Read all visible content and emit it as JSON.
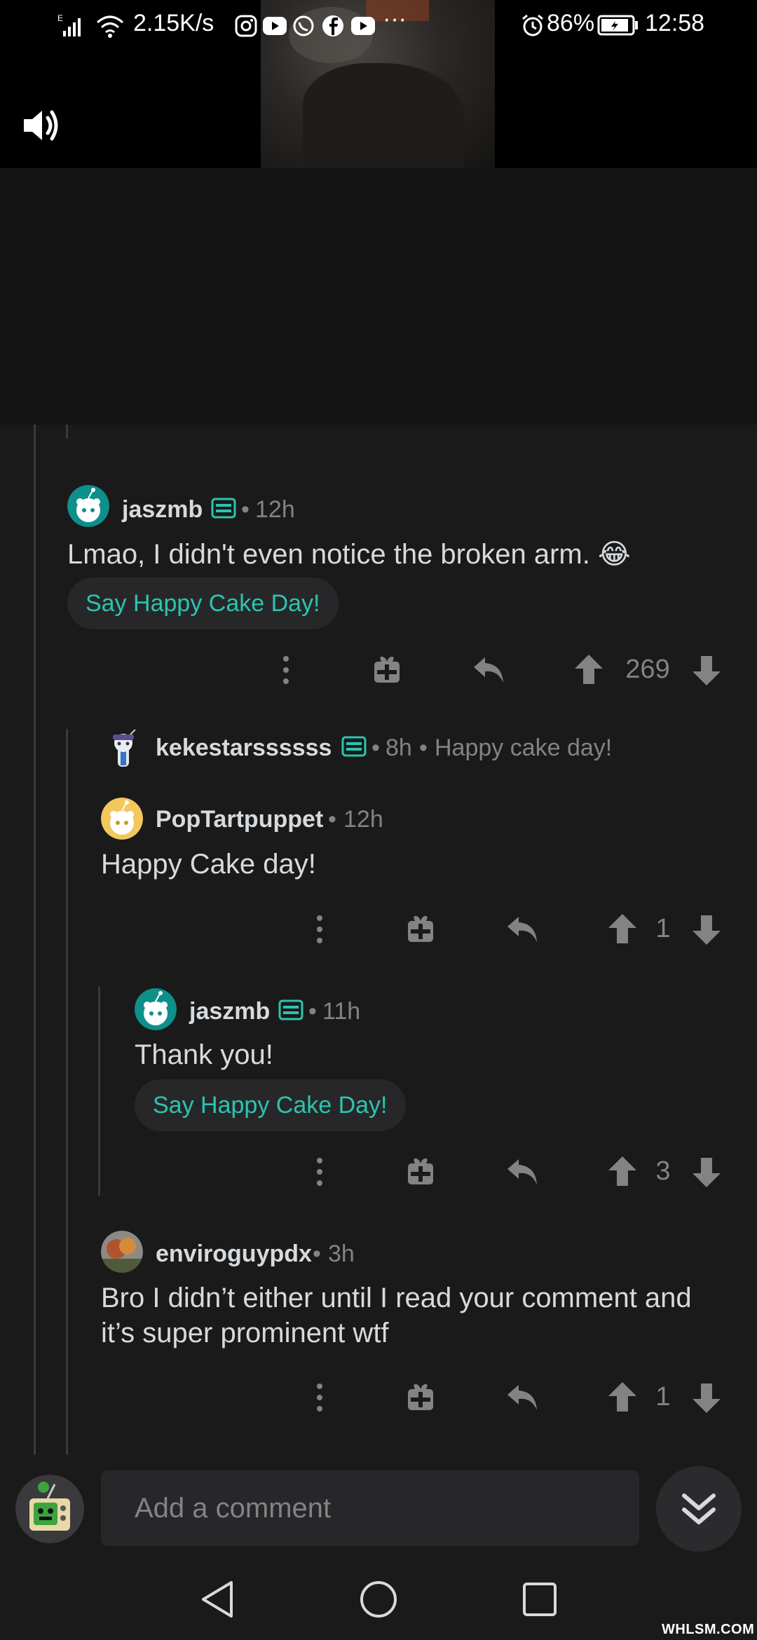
{
  "status_bar": {
    "network_speed": "2.15K/s",
    "battery": "86%",
    "time": "12:58",
    "more_indicator": "···"
  },
  "comments": [
    {
      "username": "jaszmb",
      "age": "12h",
      "text": "Lmao, I didn't even notice the broken arm. 😂",
      "cake_label": "Say Happy Cake Day!",
      "votes": "269"
    },
    {
      "username": "kekestarssssss",
      "age": "8h",
      "collapsed_preview": "Happy cake day!"
    },
    {
      "username": "PopTartpuppet",
      "age": "12h",
      "text": "Happy Cake day!",
      "votes": "1"
    },
    {
      "username": "jaszmb",
      "age": "11h",
      "text": "Thank you!",
      "cake_label": "Say Happy Cake Day!",
      "votes": "3"
    },
    {
      "username": "enviroguypdx",
      "age": "3h",
      "text": "Bro I didn’t either until I read your comment and it’s super prominent wtf",
      "votes": "1"
    }
  ],
  "separator": "•",
  "composer": {
    "placeholder": "Add a comment"
  },
  "watermark": "WHLSM.COM",
  "colors": {
    "background": "#1a1a1b",
    "accent_teal": "#2bc4b0",
    "text_primary": "#d7dadc",
    "text_secondary": "#818384"
  }
}
